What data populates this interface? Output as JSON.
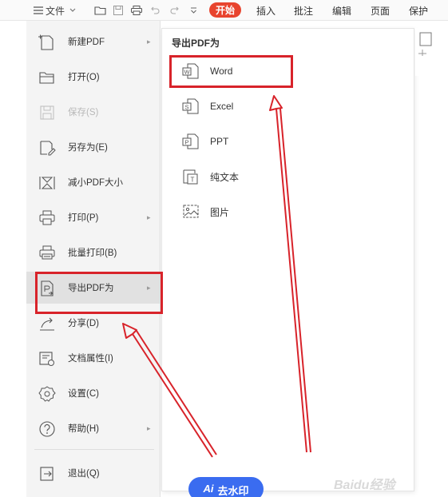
{
  "toolbar": {
    "file_label": "文件",
    "tabs": [
      "开始",
      "插入",
      "批注",
      "编辑",
      "页面",
      "保护"
    ]
  },
  "file_menu": {
    "items": [
      {
        "label": "新建PDF",
        "icon": "new-file-icon",
        "has_submenu": true,
        "enabled": true
      },
      {
        "label": "打开(O)",
        "icon": "folder-open-icon",
        "has_submenu": false,
        "enabled": true
      },
      {
        "label": "保存(S)",
        "icon": "save-icon",
        "has_submenu": false,
        "enabled": false
      },
      {
        "label": "另存为(E)",
        "icon": "save-as-icon",
        "has_submenu": false,
        "enabled": true
      },
      {
        "label": "减小PDF大小",
        "icon": "compress-icon",
        "has_submenu": false,
        "enabled": true
      },
      {
        "label": "打印(P)",
        "icon": "print-icon",
        "has_submenu": true,
        "enabled": true
      },
      {
        "label": "批量打印(B)",
        "icon": "batch-print-icon",
        "has_submenu": false,
        "enabled": true
      },
      {
        "label": "导出PDF为",
        "icon": "export-icon",
        "has_submenu": true,
        "enabled": true,
        "active": true
      },
      {
        "label": "分享(D)",
        "icon": "share-icon",
        "has_submenu": false,
        "enabled": true
      },
      {
        "label": "文档属性(I)",
        "icon": "doc-properties-icon",
        "has_submenu": false,
        "enabled": true
      },
      {
        "label": "设置(C)",
        "icon": "gear-icon",
        "has_submenu": false,
        "enabled": true
      },
      {
        "label": "帮助(H)",
        "icon": "help-icon",
        "has_submenu": true,
        "enabled": true
      },
      {
        "label": "退出(Q)",
        "icon": "exit-icon",
        "has_submenu": false,
        "enabled": true
      }
    ]
  },
  "export_submenu": {
    "title": "导出PDF为",
    "items": [
      {
        "label": "Word",
        "icon": "word-icon",
        "letter": "W"
      },
      {
        "label": "Excel",
        "icon": "excel-icon",
        "letter": "S"
      },
      {
        "label": "PPT",
        "icon": "ppt-icon",
        "letter": "P"
      },
      {
        "label": "纯文本",
        "icon": "text-icon",
        "letter": "T"
      },
      {
        "label": "图片",
        "icon": "image-icon",
        "letter": ""
      }
    ]
  },
  "colors": {
    "annotation_red": "#d8232a",
    "start_tab_bg": "#e8442e",
    "ai_button_bg": "#3a6cf0"
  },
  "watermark": {
    "ai_label": "Ai",
    "ai_text": "去水印",
    "baidu_text": "Baidu经验"
  }
}
